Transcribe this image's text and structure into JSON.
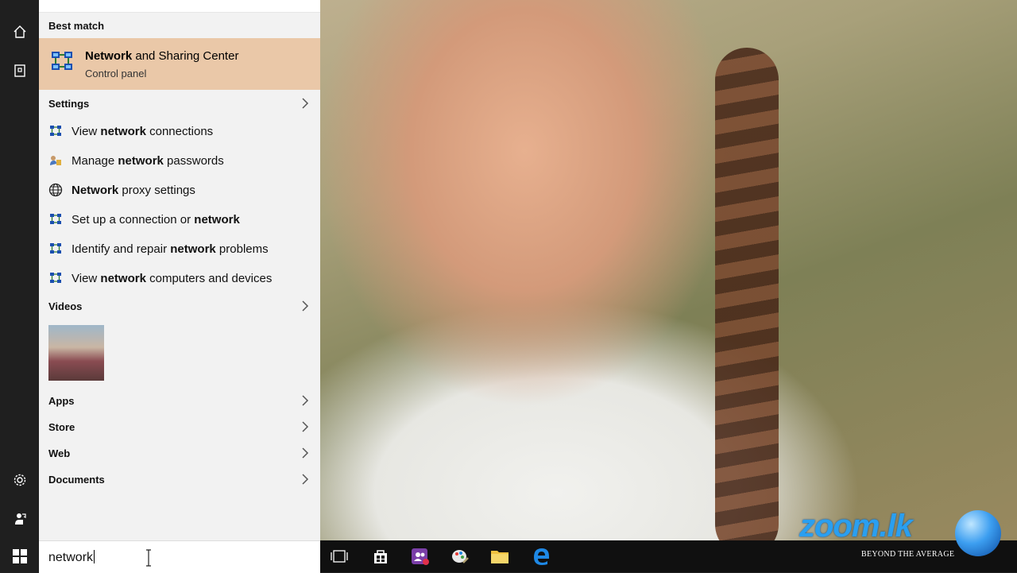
{
  "search": {
    "query": "network"
  },
  "best_match": {
    "header": "Best match",
    "title_bold": "Network",
    "title_rest": " and Sharing Center",
    "subtitle": "Control panel",
    "icon": "network-center-icon"
  },
  "settings": {
    "header": "Settings",
    "items": [
      {
        "pre": "View ",
        "bold": "network",
        "post": " connections",
        "icon": "network-center-icon"
      },
      {
        "pre": "Manage ",
        "bold": "network",
        "post": " passwords",
        "icon": "credential-manager-icon"
      },
      {
        "pre": "",
        "bold": "Network",
        "post": " proxy settings",
        "icon": "globe-icon"
      },
      {
        "pre": "Set up a connection or ",
        "bold": "network",
        "post": "",
        "icon": "network-center-icon"
      },
      {
        "pre": "Identify and repair ",
        "bold": "network",
        "post": " problems",
        "icon": "network-center-icon"
      },
      {
        "pre": "View ",
        "bold": "network",
        "post": " computers and devices",
        "icon": "network-center-icon"
      }
    ]
  },
  "videos": {
    "header": "Videos"
  },
  "categories": [
    "Apps",
    "Store",
    "Web",
    "Documents"
  ],
  "watermark": {
    "logo": "zoom.lk",
    "tagline": "BEYOND THE AVERAGE"
  },
  "colors": {
    "highlight": "#eac8a8",
    "panel": "#f2f2f2",
    "rail": "#1f1f1f",
    "taskbar": "#101010"
  }
}
